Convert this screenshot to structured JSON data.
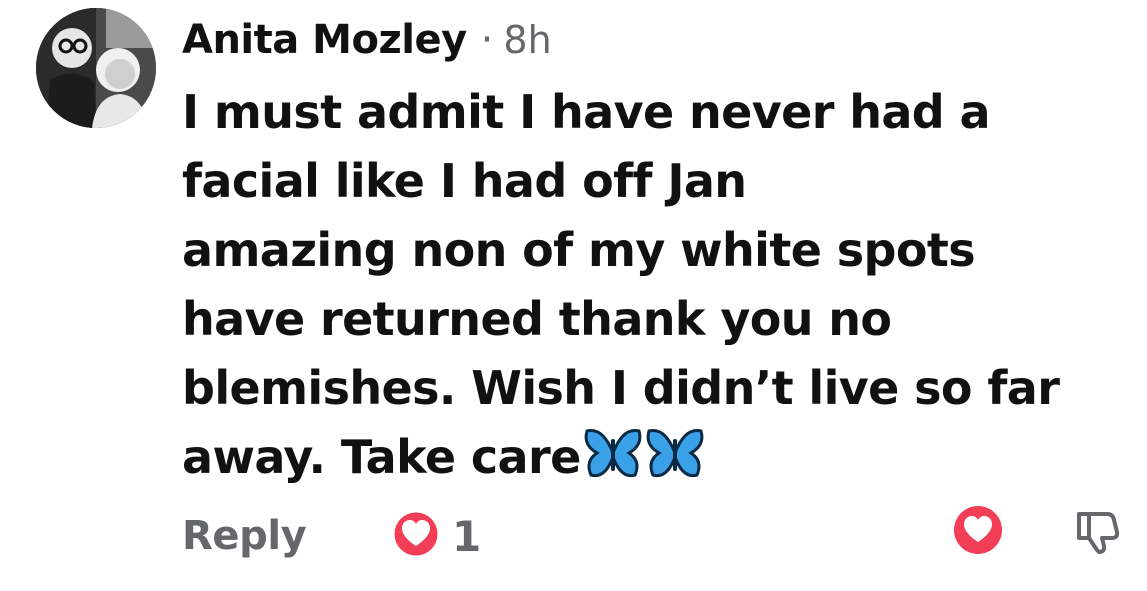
{
  "comment": {
    "author": "Anita Mozley",
    "separator": "·",
    "time": "8h",
    "lines": [
      "I must admit I have never had a",
      "facial like I had off Jan",
      "amazing non of my white spots",
      "have returned thank you no",
      "blemishes. Wish I didn’t live so far",
      "away. Take care"
    ],
    "emoji": [
      "butterfly-icon",
      "butterfly-icon"
    ]
  },
  "footer": {
    "reply_label": "Reply",
    "reaction_count": "1",
    "reaction_icon": "love-reaction-icon"
  },
  "actions": {
    "love_icon": "love-icon",
    "dislike_icon": "thumbs-down-icon"
  },
  "colors": {
    "text": "#111111",
    "muted": "#65676b",
    "love_red": "#f33e58",
    "butterfly_blue": "#3aa0e8"
  }
}
